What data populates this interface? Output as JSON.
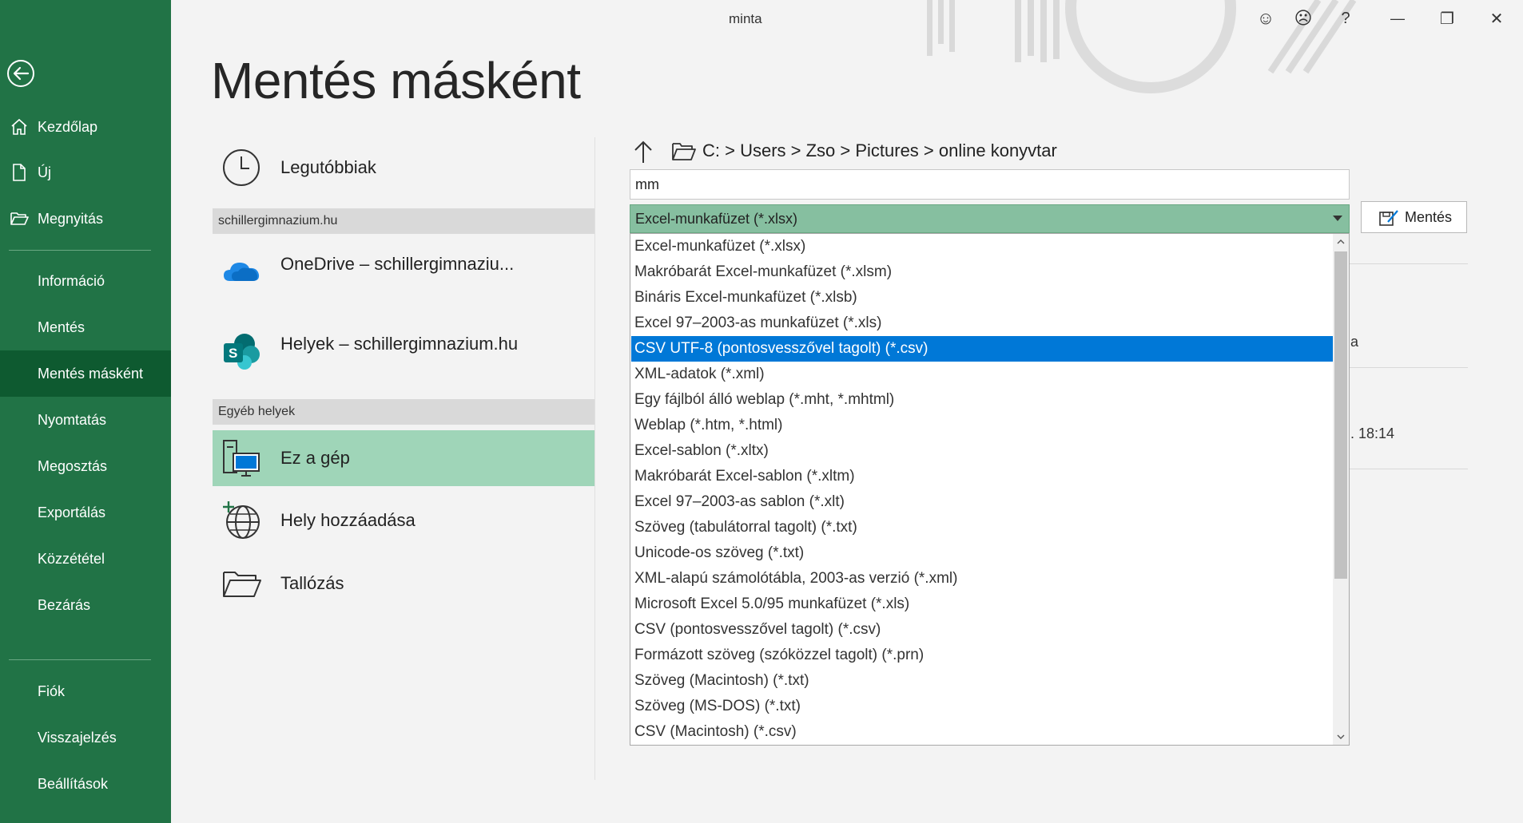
{
  "window": {
    "title": "minta",
    "controls": {
      "smile": "☺",
      "frown": "☹",
      "help": "?",
      "minimize": "—",
      "restore": "❐",
      "close": "✕"
    }
  },
  "sidebar": {
    "items": [
      {
        "label": "Kezdőlap",
        "icon": "home-icon"
      },
      {
        "label": "Új",
        "icon": "new-document-icon"
      },
      {
        "label": "Megnyitás",
        "icon": "open-folder-icon"
      },
      {
        "label": "Információ"
      },
      {
        "label": "Mentés"
      },
      {
        "label": "Mentés másként",
        "active": true
      },
      {
        "label": "Nyomtatás"
      },
      {
        "label": "Megosztás"
      },
      {
        "label": "Exportálás"
      },
      {
        "label": "Közzététel"
      },
      {
        "label": "Bezárás"
      },
      {
        "label": "Fiók"
      },
      {
        "label": "Visszajelzés"
      },
      {
        "label": "Beállítások"
      }
    ]
  },
  "main": {
    "title": "Mentés másként",
    "recent_label": "Legutóbbiak",
    "org_section": "schillergimnazium.hu",
    "onedrive_label": "OneDrive – schillergimnaziu...",
    "sites_label": "Helyek – schillergimnazium.hu",
    "other_section": "Egyéb helyek",
    "this_pc_label": "Ez a gép",
    "add_place_label": "Hely hozzáadása",
    "browse_label": "Tallózás"
  },
  "save_pane": {
    "breadcrumb": "C:  >  Users  >  Zso  >  Pictures  >  online konyvtar",
    "filename": "mm",
    "selected_type": "Excel-munkafüzet (*.xlsx)",
    "save_button": "Mentés",
    "bg_text_1": "a",
    "bg_text_2": ". 18:14",
    "file_types": [
      "Excel-munkafüzet (*.xlsx)",
      "Makróbarát Excel-munkafüzet (*.xlsm)",
      "Bináris Excel-munkafüzet (*.xlsb)",
      "Excel 97–2003-as munkafüzet (*.xls)",
      "CSV UTF-8 (pontosvesszővel tagolt) (*.csv)",
      "XML-adatok (*.xml)",
      "Egy fájlból álló weblap (*.mht, *.mhtml)",
      "Weblap (*.htm, *.html)",
      "Excel-sablon (*.xltx)",
      "Makróbarát Excel-sablon (*.xltm)",
      "Excel 97–2003-as sablon (*.xlt)",
      "Szöveg (tabulátorral tagolt) (*.txt)",
      "Unicode-os szöveg (*.txt)",
      "XML-alapú számolótábla, 2003-as verzió (*.xml)",
      "Microsoft Excel 5.0/95 munkafüzet (*.xls)",
      "CSV (pontosvesszővel tagolt) (*.csv)",
      "Formázott szöveg (szóközzel tagolt) (*.prn)",
      "Szöveg (Macintosh) (*.txt)",
      "Szöveg (MS-DOS) (*.txt)",
      "CSV (Macintosh) (*.csv)"
    ],
    "selected_index": 4
  },
  "colors": {
    "sidebar": "#217346",
    "sidebar_active": "#0e5a30",
    "location_active": "#9fd5b8",
    "dropdown_selected": "#0078d7"
  }
}
